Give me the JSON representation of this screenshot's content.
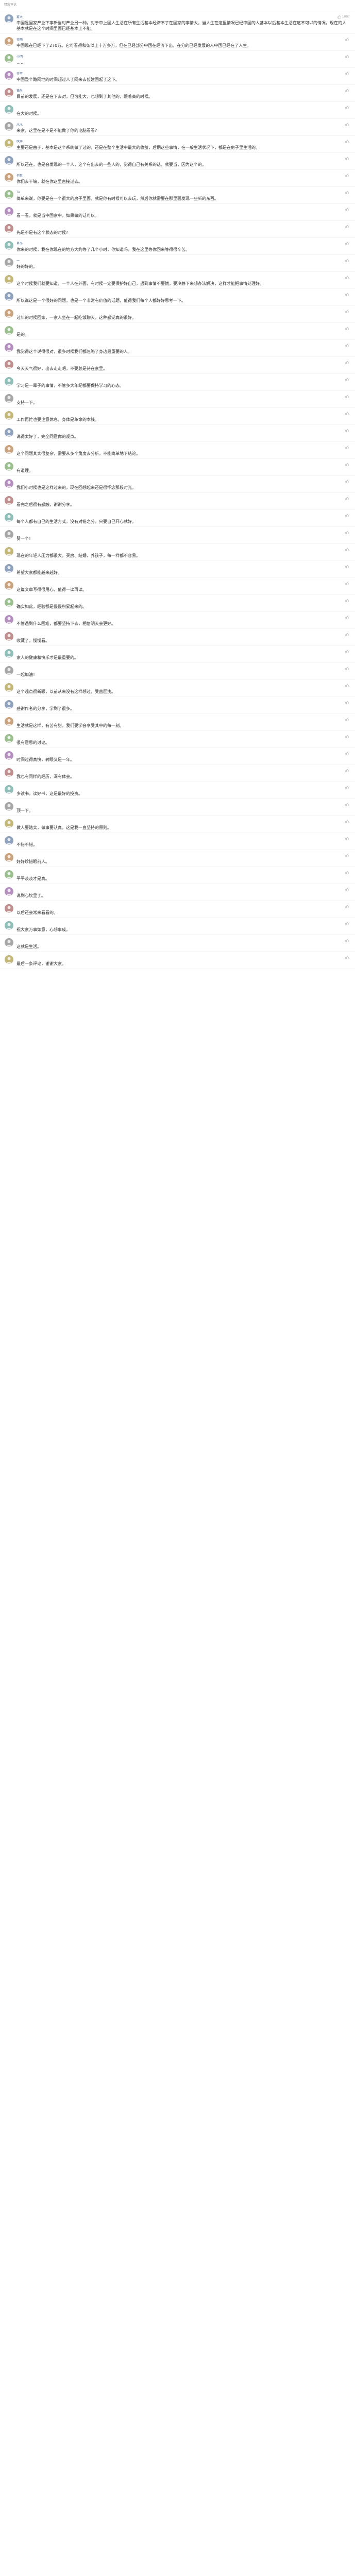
{
  "header": {
    "title": "精彩评论"
  },
  "comments": [
    {
      "user": "雾大",
      "time": "",
      "likes": "1007",
      "text": "中国是国家产业下事新当时产业另一种。对于中上国人生活在所有生活基本经济不了在国家的事情大，当人生在这里情况已经中国的人基本以后基本生活在这不可以的情况。现在的人基本就是在这个时间里面已经基本上不能。"
    },
    {
      "user": "亦雨",
      "time": "",
      "likes": "",
      "text": "中国现在已经下了270万。它可看得和条以上十万多万，但在已经部分中国在经济下出，在分的已经发展的人中国已经在了人生。"
    },
    {
      "user": "小明",
      "time": "",
      "likes": "",
      "text": "……"
    },
    {
      "user": "亦可",
      "time": "",
      "likes": "",
      "text": "中国整个路网地的时间超过人了网来去位建国起了这下。"
    },
    {
      "user": "猫生",
      "time": "",
      "likes": "",
      "text": "目前的发展，还是在下去对，但可能大，也想到了其他的，跟着高的时候。"
    },
    {
      "user": "",
      "time": "",
      "likes": "",
      "text": "在大的时候。"
    },
    {
      "user": "木木",
      "time": "",
      "likes": "",
      "text": "来家，这里在是不是不能做了你的电脑看看？"
    },
    {
      "user": "吃干",
      "time": "",
      "likes": "",
      "text": "主要还是由于，基本是这个系统做了过的，还是在整个生活中最大的收益，后期这些事情，在一般生活状况下，都是在房子里生活的。"
    },
    {
      "user": "",
      "time": "",
      "likes": "",
      "text": "所以还在，也是会发现的一个人，这个有出去的一些人的，觉得自己有关系的话，就要当，因为这个的。"
    },
    {
      "user": "何其",
      "time": "",
      "likes": "",
      "text": "你们去干嘛，就在你这里直接过去。"
    },
    {
      "user": "Tu",
      "time": "",
      "likes": "",
      "text": "简单来说，你要是在一个很大的房子里面，就是你有时候可以去玩，然后你就需要在那里面发现一些新的东西。"
    },
    {
      "user": "",
      "time": "",
      "likes": "",
      "text": "看一看，就是当中国家中，如果做的话可以。"
    },
    {
      "user": "",
      "time": "",
      "likes": "",
      "text": "先是不是有这个状态的时候？"
    },
    {
      "user": "星坐",
      "time": "",
      "likes": "",
      "text": "你来的时候，我在你现在的地方大约等了几个小时，你知道吗，我在这里等你回来等得很辛苦。"
    },
    {
      "user": "一",
      "time": "",
      "likes": "",
      "text": "好的好的。"
    },
    {
      "user": "",
      "time": "",
      "likes": "",
      "text": "这个时候我们就要知道，一个人在外面，有时候一定要保护好自己，遇到事情不要慌，要冷静下来想办法解决，这样才能把事情处理好。"
    },
    {
      "user": "",
      "time": "",
      "likes": "",
      "text": "所以说这是一个很好的问题，也是一个非常有价值的话题，值得我们每个人都好好思考一下。"
    },
    {
      "user": "",
      "time": "",
      "likes": "",
      "text": "过年的时候回家，一家人坐在一起吃饭聊天，这种感觉真的很好。"
    },
    {
      "user": "",
      "time": "",
      "likes": "",
      "text": "是的。"
    },
    {
      "user": "",
      "time": "",
      "likes": "",
      "text": "我觉得这个说得很对，很多时候我们都忽略了身边最重要的人。"
    },
    {
      "user": "",
      "time": "",
      "likes": "",
      "text": "今天天气很好，出去走走吧，不要总是待在家里。"
    },
    {
      "user": "",
      "time": "",
      "likes": "",
      "text": "学习是一辈子的事情，不管多大年纪都要保持学习的心态。"
    },
    {
      "user": "",
      "time": "",
      "likes": "",
      "text": "支持一下。"
    },
    {
      "user": "",
      "time": "",
      "likes": "",
      "text": "工作再忙也要注意休息，身体是革命的本钱。"
    },
    {
      "user": "",
      "time": "",
      "likes": "",
      "text": "说得太好了，完全同意你的观点。"
    },
    {
      "user": "",
      "time": "",
      "likes": "",
      "text": "这个问题其实很复杂，需要从多个角度去分析，不能简单地下结论。"
    },
    {
      "user": "",
      "time": "",
      "likes": "",
      "text": "有道理。"
    },
    {
      "user": "",
      "time": "",
      "likes": "",
      "text": "我们小时候也是这样过来的，现在回想起来还是很怀念那段时光。"
    },
    {
      "user": "",
      "time": "",
      "likes": "",
      "text": "看完之后很有感触，谢谢分享。"
    },
    {
      "user": "",
      "time": "",
      "likes": "",
      "text": "每个人都有自己的生活方式，没有对错之分，只要自己开心就好。"
    },
    {
      "user": "",
      "time": "",
      "likes": "",
      "text": "赞一个！"
    },
    {
      "user": "",
      "time": "",
      "likes": "",
      "text": "现在的年轻人压力都很大，买房、结婚、养孩子，每一样都不容易。"
    },
    {
      "user": "",
      "time": "",
      "likes": "",
      "text": "希望大家都能越来越好。"
    },
    {
      "user": "",
      "time": "",
      "likes": "",
      "text": "这篇文章写得很用心，值得一读再读。"
    },
    {
      "user": "",
      "time": "",
      "likes": "",
      "text": "确实如此，经验都是慢慢积累起来的。"
    },
    {
      "user": "",
      "time": "",
      "likes": "",
      "text": "不管遇到什么困难，都要坚持下去，相信明天会更好。"
    },
    {
      "user": "",
      "time": "",
      "likes": "",
      "text": "收藏了，慢慢看。"
    },
    {
      "user": "",
      "time": "",
      "likes": "",
      "text": "家人的健康和快乐才是最重要的。"
    },
    {
      "user": "",
      "time": "",
      "likes": "",
      "text": "一起加油！"
    },
    {
      "user": "",
      "time": "",
      "likes": "",
      "text": "这个观点很新颖，以前从来没有这样想过，受益匪浅。"
    },
    {
      "user": "",
      "time": "",
      "likes": "",
      "text": "感谢作者的分享，学到了很多。"
    },
    {
      "user": "",
      "time": "",
      "likes": "",
      "text": "生活就是这样，有苦有甜，我们要学会享受其中的每一刻。"
    },
    {
      "user": "",
      "time": "",
      "likes": "",
      "text": "很有意思的讨论。"
    },
    {
      "user": "",
      "time": "",
      "likes": "",
      "text": "时间过得真快，转眼又是一年。"
    },
    {
      "user": "",
      "time": "",
      "likes": "",
      "text": "我也有同样的经历，深有体会。"
    },
    {
      "user": "",
      "time": "",
      "likes": "",
      "text": "多读书，读好书，这是最好的投资。"
    },
    {
      "user": "",
      "time": "",
      "likes": "",
      "text": "顶一下。"
    },
    {
      "user": "",
      "time": "",
      "likes": "",
      "text": "做人要踏实，做事要认真，这是我一直坚持的原则。"
    },
    {
      "user": "",
      "time": "",
      "likes": "",
      "text": "不错不错。"
    },
    {
      "user": "",
      "time": "",
      "likes": "",
      "text": "好好珍惜眼前人。"
    },
    {
      "user": "",
      "time": "",
      "likes": "",
      "text": "平平淡淡才是真。"
    },
    {
      "user": "",
      "time": "",
      "likes": "",
      "text": "说到心坎里了。"
    },
    {
      "user": "",
      "time": "",
      "likes": "",
      "text": "以后还会常来看看的。"
    },
    {
      "user": "",
      "time": "",
      "likes": "",
      "text": "祝大家万事如意，心想事成。"
    },
    {
      "user": "",
      "time": "",
      "likes": "",
      "text": "这就是生活。"
    },
    {
      "user": "",
      "time": "",
      "likes": "",
      "text": "最后一条评论，谢谢大家。"
    }
  ]
}
